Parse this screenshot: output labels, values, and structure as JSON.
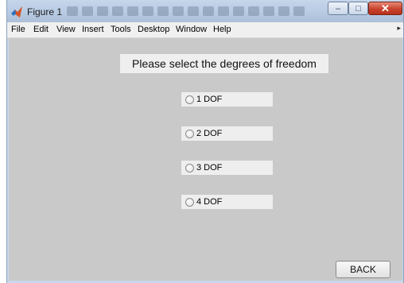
{
  "window": {
    "title": "Figure 1",
    "controls": {
      "minimize": "–",
      "maximize": "□",
      "close": "✕"
    }
  },
  "menubar": {
    "items": [
      "File",
      "Edit",
      "View",
      "Insert",
      "Tools",
      "Desktop",
      "Window",
      "Help"
    ],
    "overflow": "▸"
  },
  "panel": {
    "heading": "Please select the degrees of freedom"
  },
  "options": [
    {
      "label": "1 DOF",
      "selected": false
    },
    {
      "label": "2 DOF",
      "selected": false
    },
    {
      "label": "3 DOF",
      "selected": false
    },
    {
      "label": "4 DOF",
      "selected": false
    }
  ],
  "actions": {
    "back_label": "BACK"
  },
  "colors": {
    "figure_background": "#c9c9c9",
    "panel_background": "#efefef",
    "close_button": "#c8432c"
  },
  "icons": {
    "app": "matlab-icon",
    "radio": "radio-button-icon"
  }
}
